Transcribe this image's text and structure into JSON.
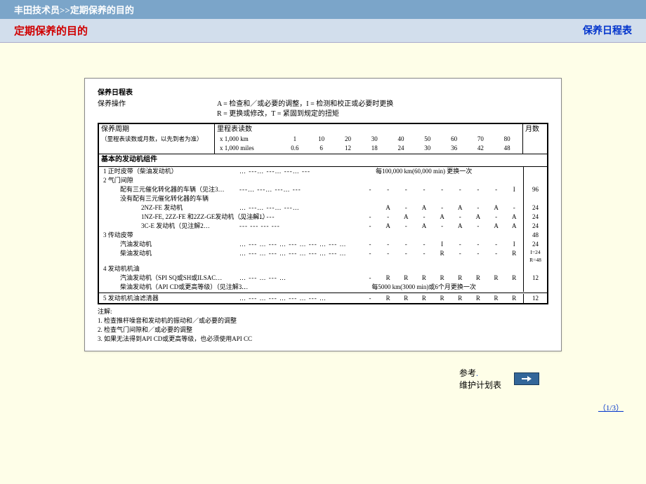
{
  "header": {
    "breadcrumb": "丰田技术员>>定期保养的目的"
  },
  "subheader": {
    "left": "定期保养的目的",
    "right": "保养日程表"
  },
  "sheet": {
    "title": "保养日程表",
    "ops_label": "保养操作",
    "legend1": "A = 检查和／或必要的调整，I = 检测和校正或必要时更换",
    "legend2": "R = 更换或修改，T = 紧固到规定的扭矩",
    "period_label": "保养周期",
    "period_sub": "（里程表读数或月数，以先到者为准）",
    "odo_label": "里程表读数",
    "months_label": "月数",
    "unit_km": "x 1,000 km",
    "unit_mi": "x 1,000 miles",
    "km_vals": [
      "1",
      "10",
      "20",
      "30",
      "40",
      "50",
      "60",
      "70",
      "80"
    ],
    "mi_vals": [
      "0.6",
      "6",
      "12",
      "18",
      "24",
      "30",
      "36",
      "42",
      "48"
    ],
    "section_engine": "基本的发动机组件",
    "items": {
      "i1": "1 正时皮带（柴油发动机）",
      "i1_note": "每100,000 km(60,000 min) 更换一次",
      "i2": "2 气门间隙",
      "i2a": "配有三元催化转化器的车辆（见注3…",
      "i2b": "没有配有三元催化转化器的车辆",
      "i2b1": "2NZ-FE 发动机",
      "i2b2": "1NZ-FE, 2ZZ-FE 和2ZZ-GE发动机（见注解1）",
      "i2b3": "3C-E 发动机（见注解2…",
      "i3": "3 传动皮带",
      "i3a": "汽油发动机",
      "i3b": "柴油发动机",
      "i4": "4 发动机机油",
      "i4a": "汽油发动机（SPI SQ或SH或ILSAC…",
      "i4b": "柴油发动机（API CD或更高等级）（见注解3…",
      "i4b_note": "每5000 km(3000 min)或6个月更换一次",
      "i5": "5 发动机机油滤清器"
    },
    "marks": {
      "i2a": [
        "",
        "",
        "",
        "",
        "",
        "",
        "",
        "",
        "I"
      ],
      "i2a_m": "96",
      "i2b1": [
        "",
        "A",
        "",
        "A",
        "",
        "A",
        "",
        "A",
        ""
      ],
      "i2b1_m": "24",
      "i2b2": [
        "",
        "",
        "A",
        "",
        "A",
        "",
        "A",
        "",
        "A"
      ],
      "i2b2_m": "24",
      "i2b3": [
        "",
        "A",
        "",
        "A",
        "",
        "A",
        "",
        "A",
        "A"
      ],
      "i2b3_m": "24",
      "i3_m": "48",
      "i3a": [
        "",
        "",
        "",
        "",
        "I",
        "",
        "",
        "",
        "I"
      ],
      "i3a_m": "24",
      "i3b": [
        "",
        "",
        "",
        "",
        "R",
        "",
        "",
        "",
        "R"
      ],
      "i3b_m": "I=24\nR=48",
      "i4a": [
        "",
        "R",
        "R",
        "R",
        "R",
        "R",
        "R",
        "R",
        "R"
      ],
      "i4a_m": "12",
      "i5": [
        "",
        "R",
        "R",
        "R",
        "R",
        "R",
        "R",
        "R",
        "R"
      ],
      "i5_m": "12"
    },
    "notes_title": "注解:",
    "note1": "1. 检查推杆噪音和发动机的振动和／或必要的调整",
    "note2": "2. 检查气门间隙和／或必要的调整",
    "note3": "3. 如果无法得到API CD或更高等级，也必须使用API CC"
  },
  "footer": {
    "ref": "参考",
    "plan": "维护计划表"
  },
  "pager": "（1/3）"
}
